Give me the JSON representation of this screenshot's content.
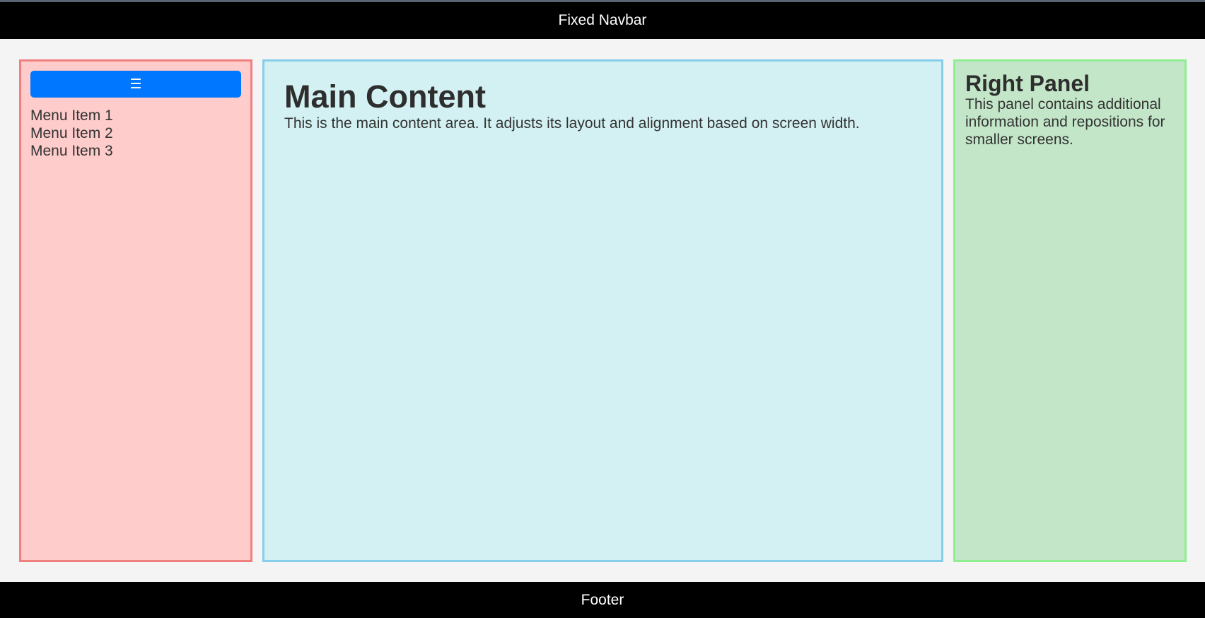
{
  "navbar": {
    "title": "Fixed Navbar"
  },
  "sidebar": {
    "toggle_icon": "☰",
    "toggle_icon_name": "hamburger-menu-icon",
    "items": [
      {
        "label": "Menu Item 1"
      },
      {
        "label": "Menu Item 2"
      },
      {
        "label": "Menu Item 3"
      }
    ]
  },
  "main": {
    "heading": "Main Content",
    "text": "This is the main content area. It adjusts its layout and alignment based on screen width."
  },
  "right_panel": {
    "heading": "Right Panel",
    "text": "This panel contains additional information and repositions for smaller screens."
  },
  "footer": {
    "text": "Footer"
  },
  "colors": {
    "navbar_bg": "#000000",
    "sidebar_bg": "#ffcccc",
    "sidebar_border": "#f08080",
    "main_bg": "#d3f1f3",
    "main_border": "#87ceeb",
    "right_bg": "#c3e6c8",
    "right_border": "#90ee90",
    "toggle_button": "#0077ff",
    "footer_bg": "#000000"
  }
}
